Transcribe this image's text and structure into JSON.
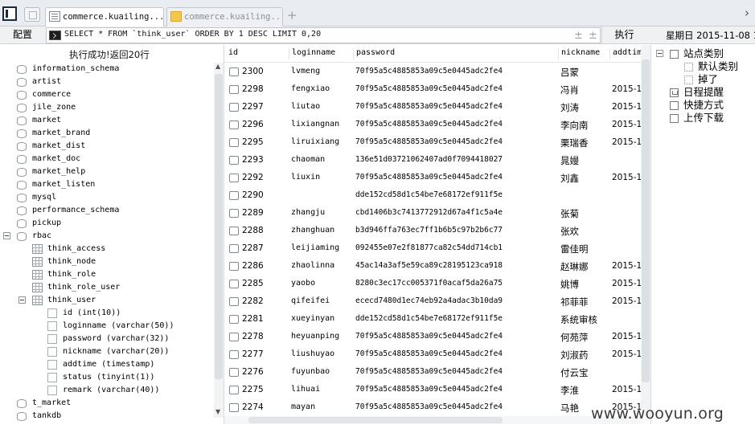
{
  "tabs": [
    {
      "label": "commerce.kuailing...",
      "active": true
    },
    {
      "label": "commerce.kuailing...",
      "active": false
    }
  ],
  "toolbar": {
    "config_label": "配置",
    "sql_text": "SELECT * FROM `think_user` ORDER BY 1 DESC LIMIT 0,20",
    "exec_label": "执行",
    "date": "星期日 2015-11-08 1"
  },
  "left_panel": {
    "status": "执行成功!返回20行",
    "databases_top": [
      "information_schema",
      "artist",
      "commerce",
      "jile_zone",
      "market",
      "market_brand",
      "market_dist",
      "market_doc",
      "market_help",
      "market_listen",
      "mysql",
      "performance_schema",
      "pickup"
    ],
    "rbac": {
      "name": "rbac",
      "tables": [
        "think_access",
        "think_node",
        "think_role",
        "think_role_user"
      ],
      "open_table": {
        "name": "think_user",
        "columns": [
          "id (int(10))",
          "loginname (varchar(50))",
          "password (varchar(32))",
          "nickname (varchar(20))",
          "addtime (timestamp)",
          "status (tinyint(1))",
          "remark (varchar(40))"
        ]
      }
    },
    "databases_bottom": [
      "t_market",
      "tankdb"
    ]
  },
  "grid": {
    "headers": [
      "id",
      "loginname",
      "password",
      "nickname",
      "addtim"
    ],
    "rows": [
      {
        "id": "2300",
        "loginname": "lvmeng",
        "password": "70f95a5c4885853a09c5e0445adc2fe4",
        "nickname": "吕蒙",
        "addtime": ""
      },
      {
        "id": "2298",
        "loginname": "fengxiao",
        "password": "70f95a5c4885853a09c5e0445adc2fe4",
        "nickname": "冯肖",
        "addtime": "2015-1"
      },
      {
        "id": "2297",
        "loginname": "liutao",
        "password": "70f95a5c4885853a09c5e0445adc2fe4",
        "nickname": "刘涛",
        "addtime": "2015-1"
      },
      {
        "id": "2296",
        "loginname": "lixiangnan",
        "password": "70f95a5c4885853a09c5e0445adc2fe4",
        "nickname": "李向南",
        "addtime": "2015-1"
      },
      {
        "id": "2295",
        "loginname": "liruixiang",
        "password": "70f95a5c4885853a09c5e0445adc2fe4",
        "nickname": "栗瑞香",
        "addtime": "2015-1"
      },
      {
        "id": "2293",
        "loginname": "chaoman",
        "password": "136e51d03721062407ad0f7094418027",
        "nickname": "晁嫚",
        "addtime": ""
      },
      {
        "id": "2292",
        "loginname": "liuxin",
        "password": "70f95a5c4885853a09c5e0445adc2fe4",
        "nickname": "刘鑫",
        "addtime": "2015-1"
      },
      {
        "id": "2290",
        "loginname": "",
        "password": "dde152cd58d1c54be7e68172ef911f5e",
        "nickname": "",
        "addtime": ""
      },
      {
        "id": "2289",
        "loginname": "zhangju",
        "password": "cbd1406b3c7413772912d67a4f1c5a4e",
        "nickname": "张菊",
        "addtime": ""
      },
      {
        "id": "2288",
        "loginname": "zhanghuan",
        "password": "b3d946ffa763ec7ff1b6b5c97b2b6c77",
        "nickname": "张欢",
        "addtime": ""
      },
      {
        "id": "2287",
        "loginname": "leijiaming",
        "password": "092455e07e2f81877ca82c54dd714cb1",
        "nickname": "雷佳明",
        "addtime": ""
      },
      {
        "id": "2286",
        "loginname": "zhaolinna",
        "password": "45ac14a3af5e59ca89c28195123ca918",
        "nickname": "赵琳娜",
        "addtime": "2015-1"
      },
      {
        "id": "2285",
        "loginname": "yaobo",
        "password": "8280c3ec17cc005371f0acaf5da26a75",
        "nickname": "姚博",
        "addtime": "2015-1"
      },
      {
        "id": "2282",
        "loginname": "qifeifei",
        "password": "ececd7480d1ec74eb92a4adac3b10da9",
        "nickname": "祁菲菲",
        "addtime": "2015-1"
      },
      {
        "id": "2281",
        "loginname": "xueyinyan",
        "password": "dde152cd58d1c54be7e68172ef911f5e",
        "nickname": "系统审核",
        "addtime": ""
      },
      {
        "id": "2278",
        "loginname": "heyuanping",
        "password": "70f95a5c4885853a09c5e0445adc2fe4",
        "nickname": "何苑萍",
        "addtime": "2015-1"
      },
      {
        "id": "2277",
        "loginname": "liushuyao",
        "password": "70f95a5c4885853a09c5e0445adc2fe4",
        "nickname": "刘淑药",
        "addtime": "2015-1"
      },
      {
        "id": "2276",
        "loginname": "fuyunbao",
        "password": "70f95a5c4885853a09c5e0445adc2fe4",
        "nickname": "付云宝",
        "addtime": ""
      },
      {
        "id": "2275",
        "loginname": "lihuai",
        "password": "70f95a5c4885853a09c5e0445adc2fe4",
        "nickname": "李淮",
        "addtime": "2015-1"
      },
      {
        "id": "2274",
        "loginname": "mayan",
        "password": "70f95a5c4885853a09c5e0445adc2fe4",
        "nickname": "马艳",
        "addtime": "2015-1"
      }
    ]
  },
  "right_panel": {
    "site_category": "站点类别",
    "site_children": [
      "默认类别",
      "掉了"
    ],
    "items": [
      "日程提醒",
      "快捷方式",
      "上传下载"
    ]
  },
  "watermark": "www.wooyun.org"
}
